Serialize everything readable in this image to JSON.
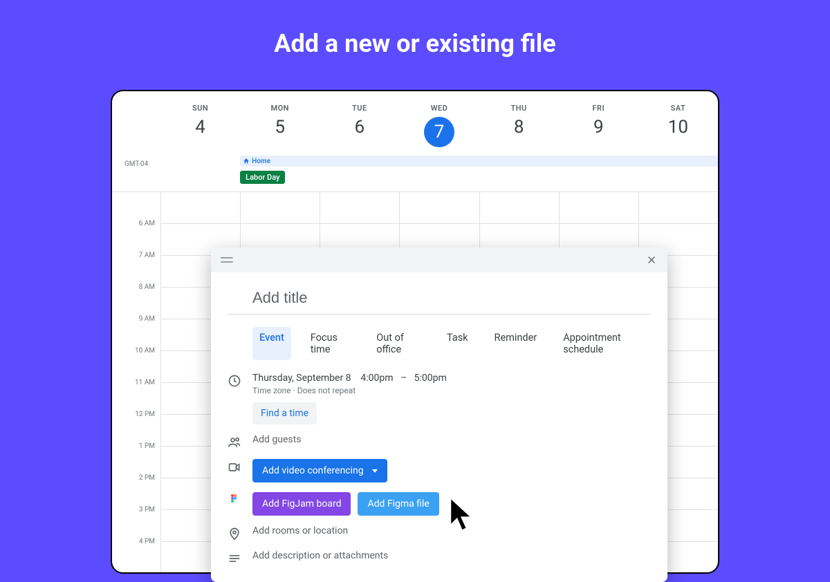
{
  "hero": {
    "title": "Add a new or existing file"
  },
  "calendar": {
    "timezone": "GMT-04",
    "days": [
      {
        "name": "SUN",
        "num": "4"
      },
      {
        "name": "MON",
        "num": "5"
      },
      {
        "name": "TUE",
        "num": "6"
      },
      {
        "name": "WED",
        "num": "7",
        "today": true
      },
      {
        "name": "THU",
        "num": "8"
      },
      {
        "name": "FRI",
        "num": "9"
      },
      {
        "name": "SAT",
        "num": "10"
      }
    ],
    "home_label": "Home",
    "allday_event": "Labor Day",
    "hours": [
      "6 AM",
      "7 AM",
      "8 AM",
      "9 AM",
      "10 AM",
      "11 AM",
      "12 PM",
      "1 PM",
      "2 PM",
      "3 PM",
      "4 PM"
    ]
  },
  "popup": {
    "title_placeholder": "Add title",
    "tabs": [
      "Event",
      "Focus time",
      "Out of office",
      "Task",
      "Reminder",
      "Appointment schedule"
    ],
    "active_tab": "Event",
    "date_label": "Thursday, September 8",
    "start_time": "4:00pm",
    "dash": "–",
    "end_time": "5:00pm",
    "meta": "Time zone · Does not repeat",
    "find_time": "Find a time",
    "guests_placeholder": "Add guests",
    "video_button": "Add video conferencing",
    "figjam_button": "Add FigJam board",
    "figma_button": "Add Figma file",
    "location_placeholder": "Add rooms or location",
    "description_placeholder": "Add description or attachments"
  }
}
